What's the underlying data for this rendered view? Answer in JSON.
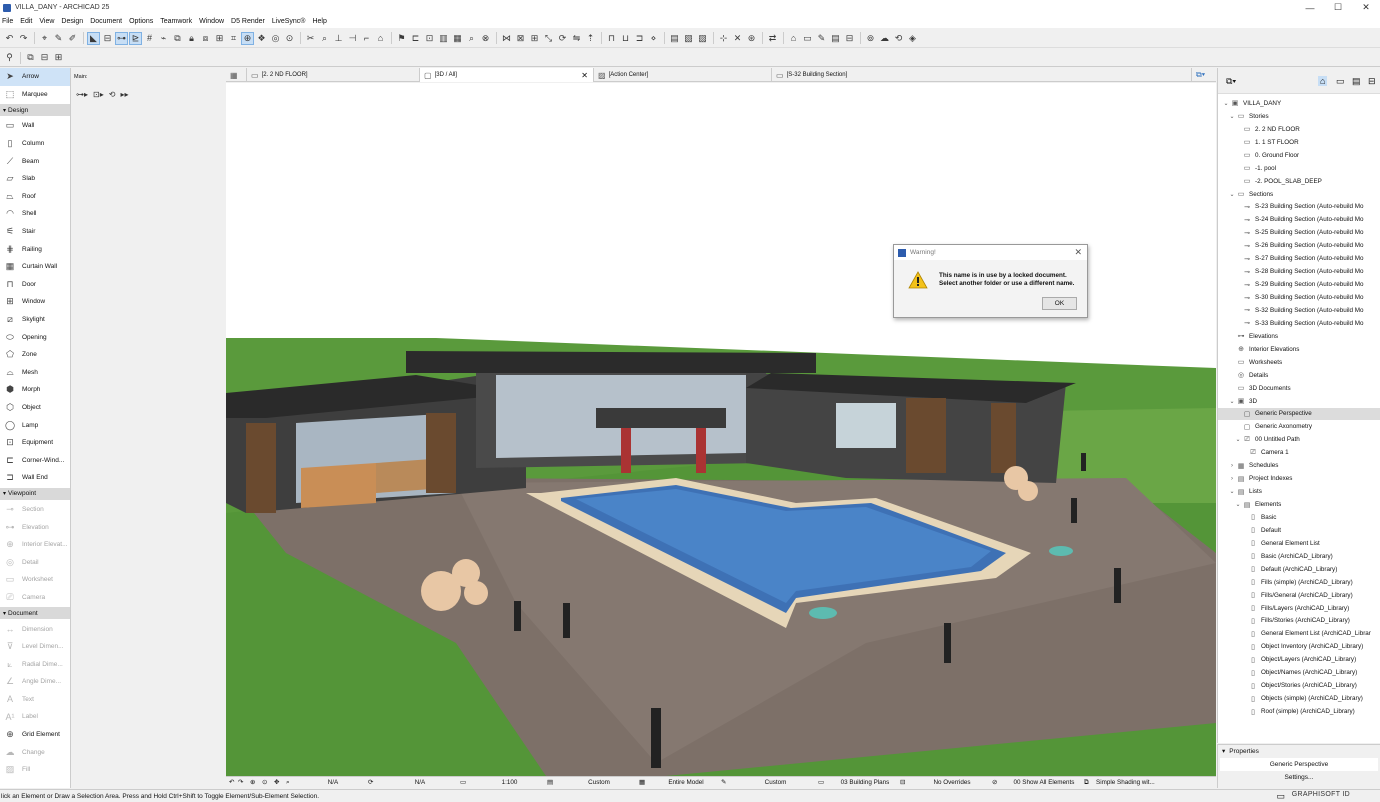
{
  "window": {
    "title": "VILLA_DANY - ARCHICAD 25",
    "controls": [
      "—",
      "☐",
      "✕"
    ]
  },
  "menu": [
    "File",
    "Edit",
    "View",
    "Design",
    "Document",
    "Options",
    "Teamwork",
    "Window",
    "D5 Render",
    "LiveSync®",
    "Help"
  ],
  "toolbox": {
    "top_tools": [
      {
        "label": "Arrow",
        "icon": "arrow-icon",
        "selected": true
      },
      {
        "label": "Marquee",
        "icon": "marquee-icon"
      }
    ],
    "design_header": "Design",
    "design_tools": [
      {
        "label": "Wall",
        "icon": "wall-icon"
      },
      {
        "label": "Column",
        "icon": "column-icon"
      },
      {
        "label": "Beam",
        "icon": "beam-icon"
      },
      {
        "label": "Slab",
        "icon": "slab-icon"
      },
      {
        "label": "Roof",
        "icon": "roof-icon"
      },
      {
        "label": "Shell",
        "icon": "shell-icon"
      },
      {
        "label": "Stair",
        "icon": "stair-icon"
      },
      {
        "label": "Railing",
        "icon": "railing-icon"
      },
      {
        "label": "Curtain Wall",
        "icon": "curtain-wall-icon"
      },
      {
        "label": "Door",
        "icon": "door-icon"
      },
      {
        "label": "Window",
        "icon": "window-icon"
      },
      {
        "label": "Skylight",
        "icon": "skylight-icon"
      },
      {
        "label": "Opening",
        "icon": "opening-icon"
      },
      {
        "label": "Zone",
        "icon": "zone-icon"
      },
      {
        "label": "Mesh",
        "icon": "mesh-icon"
      },
      {
        "label": "Morph",
        "icon": "morph-icon"
      },
      {
        "label": "Object",
        "icon": "object-icon"
      },
      {
        "label": "Lamp",
        "icon": "lamp-icon"
      },
      {
        "label": "Equipment",
        "icon": "equipment-icon"
      },
      {
        "label": "Corner-Wind...",
        "icon": "corner-window-icon"
      },
      {
        "label": "Wall End",
        "icon": "wall-end-icon"
      }
    ],
    "viewpoint_header": "Viewpoint",
    "viewpoint_tools": [
      {
        "label": "Section",
        "icon": "section-icon"
      },
      {
        "label": "Elevation",
        "icon": "elevation-icon"
      },
      {
        "label": "Interior Elevat...",
        "icon": "interior-elevation-icon"
      },
      {
        "label": "Detail",
        "icon": "detail-icon"
      },
      {
        "label": "Worksheet",
        "icon": "worksheet-icon"
      },
      {
        "label": "Camera",
        "icon": "camera-icon"
      }
    ],
    "document_header": "Document",
    "document_tools": [
      {
        "label": "Dimension",
        "icon": "dimension-icon",
        "dim": true
      },
      {
        "label": "Level Dimen...",
        "icon": "level-dimension-icon",
        "dim": true
      },
      {
        "label": "Radial Dime...",
        "icon": "radial-dimension-icon",
        "dim": true
      },
      {
        "label": "Angle Dime...",
        "icon": "angle-dimension-icon",
        "dim": true
      },
      {
        "label": "Text",
        "icon": "text-icon",
        "dim": true
      },
      {
        "label": "Label",
        "icon": "label-icon",
        "dim": true
      },
      {
        "label": "Grid Element",
        "icon": "grid-element-icon",
        "dim": false
      },
      {
        "label": "Change",
        "icon": "change-icon",
        "dim": true
      },
      {
        "label": "Fill",
        "icon": "fill-icon",
        "dim": true
      }
    ]
  },
  "infobox": {
    "label": "Main:"
  },
  "tabs": [
    {
      "label": "[2. 2 ND FLOOR]",
      "icon": "floor-plan-icon"
    },
    {
      "label": "[3D / All]",
      "icon": "3d-view-icon",
      "active": true
    },
    {
      "label": "[Action Center]",
      "icon": "action-center-icon"
    },
    {
      "label": "[S-32 Building Section]",
      "icon": "section-view-icon"
    }
  ],
  "dialog": {
    "title": "Warning!",
    "line1": "This name is in use by a locked document.",
    "line2": "Select another folder or use a different name.",
    "ok": "OK"
  },
  "viewport_status": {
    "zoom1": "N/A",
    "zoom2": "N/A",
    "scale": "1:100",
    "layer_combo": "Custom",
    "model_filter": "Entire Model",
    "pen_set": "Custom",
    "mvo": "03 Building Plans",
    "overrides": "No Overrides",
    "renovation": "00 Show All Elements",
    "shading": "Simple Shading wit..."
  },
  "navigator": {
    "items": [
      {
        "label": "VILLA_DANY",
        "depth": 0,
        "tw": "v",
        "icon": "project-icon"
      },
      {
        "label": "Stories",
        "depth": 1,
        "tw": "v",
        "icon": "folder-icon"
      },
      {
        "label": "2. 2 ND FLOOR",
        "depth": 2,
        "tw": "",
        "icon": "story-icon"
      },
      {
        "label": "1. 1 ST FLOOR",
        "depth": 2,
        "tw": "",
        "icon": "story-icon"
      },
      {
        "label": "0. Ground Floor",
        "depth": 2,
        "tw": "",
        "icon": "story-icon"
      },
      {
        "label": "-1. pool",
        "depth": 2,
        "tw": "",
        "icon": "story-icon"
      },
      {
        "label": "-2. POOL_SLAB_DEEP",
        "depth": 2,
        "tw": "",
        "icon": "story-icon"
      },
      {
        "label": "Sections",
        "depth": 1,
        "tw": "v",
        "icon": "folder-icon"
      },
      {
        "label": "S-23 Building Section (Auto-rebuild Mo",
        "depth": 2,
        "tw": "",
        "icon": "section-icon"
      },
      {
        "label": "S-24 Building Section (Auto-rebuild Mo",
        "depth": 2,
        "tw": "",
        "icon": "section-icon"
      },
      {
        "label": "S-25 Building Section (Auto-rebuild Mo",
        "depth": 2,
        "tw": "",
        "icon": "section-icon"
      },
      {
        "label": "S-26 Building Section (Auto-rebuild Mo",
        "depth": 2,
        "tw": "",
        "icon": "section-icon"
      },
      {
        "label": "S-27 Building Section (Auto-rebuild Mo",
        "depth": 2,
        "tw": "",
        "icon": "section-icon"
      },
      {
        "label": "S-28 Building Section (Auto-rebuild Mo",
        "depth": 2,
        "tw": "",
        "icon": "section-icon"
      },
      {
        "label": "S-29 Building Section (Auto-rebuild Mo",
        "depth": 2,
        "tw": "",
        "icon": "section-icon"
      },
      {
        "label": "S-30 Building Section (Auto-rebuild Mo",
        "depth": 2,
        "tw": "",
        "icon": "section-icon"
      },
      {
        "label": "S-32 Building Section (Auto-rebuild Mo",
        "depth": 2,
        "tw": "",
        "icon": "section-icon"
      },
      {
        "label": "S-33 Building Section (Auto-rebuild Mo",
        "depth": 2,
        "tw": "",
        "icon": "section-icon"
      },
      {
        "label": "Elevations",
        "depth": 1,
        "tw": "",
        "icon": "elevation-icon"
      },
      {
        "label": "Interior Elevations",
        "depth": 1,
        "tw": "",
        "icon": "interior-elevation-icon"
      },
      {
        "label": "Worksheets",
        "depth": 1,
        "tw": "",
        "icon": "worksheet-icon"
      },
      {
        "label": "Details",
        "depth": 1,
        "tw": "",
        "icon": "detail-icon"
      },
      {
        "label": "3D Documents",
        "depth": 1,
        "tw": "",
        "icon": "3d-document-icon"
      },
      {
        "label": "3D",
        "depth": 1,
        "tw": "v",
        "icon": "3d-icon"
      },
      {
        "label": "Generic Perspective",
        "depth": 2,
        "tw": "",
        "icon": "perspective-icon",
        "selected": true
      },
      {
        "label": "Generic Axonometry",
        "depth": 2,
        "tw": "",
        "icon": "axonometry-icon"
      },
      {
        "label": "00 Untitled Path",
        "depth": 2,
        "tw": "v",
        "icon": "path-icon"
      },
      {
        "label": "Camera 1",
        "depth": 3,
        "tw": "",
        "icon": "camera-icon"
      },
      {
        "label": "Schedules",
        "depth": 1,
        "tw": ">",
        "icon": "schedule-icon"
      },
      {
        "label": "Project Indexes",
        "depth": 1,
        "tw": ">",
        "icon": "index-icon"
      },
      {
        "label": "Lists",
        "depth": 1,
        "tw": "v",
        "icon": "list-icon"
      },
      {
        "label": "Elements",
        "depth": 2,
        "tw": "v",
        "icon": "elements-icon"
      },
      {
        "label": "Basic",
        "depth": 3,
        "tw": "",
        "icon": "doc-icon"
      },
      {
        "label": "Default",
        "depth": 3,
        "tw": "",
        "icon": "doc-icon"
      },
      {
        "label": "General Element List",
        "depth": 3,
        "tw": "",
        "icon": "doc-icon"
      },
      {
        "label": "Basic (ArchiCAD_Library)",
        "depth": 3,
        "tw": "",
        "icon": "doc-icon"
      },
      {
        "label": "Default (ArchiCAD_Library)",
        "depth": 3,
        "tw": "",
        "icon": "doc-icon"
      },
      {
        "label": "Fills (simple) (ArchiCAD_Library)",
        "depth": 3,
        "tw": "",
        "icon": "doc-icon"
      },
      {
        "label": "Fills/General (ArchiCAD_Library)",
        "depth": 3,
        "tw": "",
        "icon": "doc-icon"
      },
      {
        "label": "Fills/Layers (ArchiCAD_Library)",
        "depth": 3,
        "tw": "",
        "icon": "doc-icon"
      },
      {
        "label": "Fills/Stories (ArchiCAD_Library)",
        "depth": 3,
        "tw": "",
        "icon": "doc-icon"
      },
      {
        "label": "General Element List (ArchiCAD_Librar",
        "depth": 3,
        "tw": "",
        "icon": "doc-icon"
      },
      {
        "label": "Object Inventory (ArchiCAD_Library)",
        "depth": 3,
        "tw": "",
        "icon": "doc-icon"
      },
      {
        "label": "Object/Layers (ArchiCAD_Library)",
        "depth": 3,
        "tw": "",
        "icon": "doc-icon"
      },
      {
        "label": "Object/Names (ArchiCAD_Library)",
        "depth": 3,
        "tw": "",
        "icon": "doc-icon"
      },
      {
        "label": "Object/Stories (ArchiCAD_Library)",
        "depth": 3,
        "tw": "",
        "icon": "doc-icon"
      },
      {
        "label": "Objects (simple) (ArchiCAD_Library)",
        "depth": 3,
        "tw": "",
        "icon": "doc-icon"
      },
      {
        "label": "Roof (simple) (ArchiCAD_Library)",
        "depth": 3,
        "tw": "",
        "icon": "doc-icon"
      }
    ]
  },
  "properties": {
    "header": "Properties",
    "value": "Generic Perspective",
    "settings": "Settings..."
  },
  "statusbar": {
    "message": "lick an Element or Draw a Selection Area. Press and Hold Ctrl+Shift to Toggle Element/Sub-Element Selection.",
    "logo": "GRAPHISOFT ID"
  }
}
